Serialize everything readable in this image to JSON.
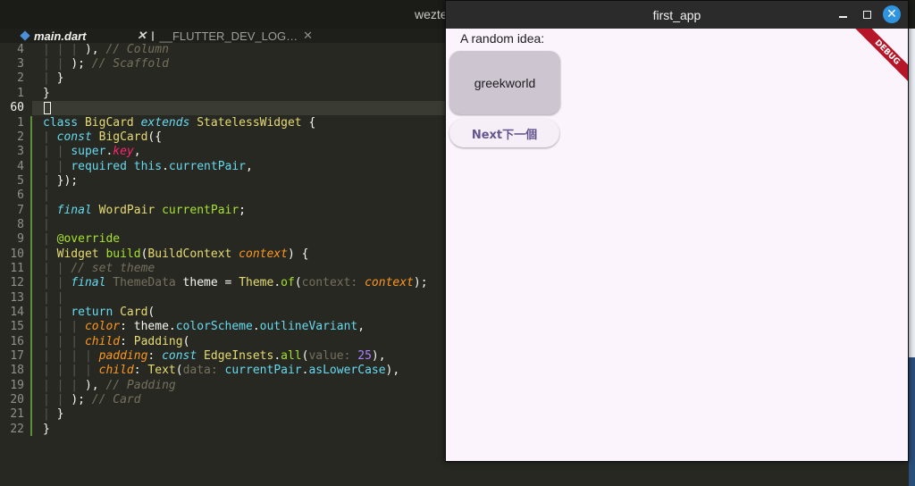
{
  "editor": {
    "window_title": "wezte",
    "tabs": [
      {
        "label": "main.dart",
        "close": "✕"
      },
      {
        "label": "__FLUTTER_DEV_LOG…",
        "close": "✕"
      }
    ],
    "line_numbers": [
      "4",
      "3",
      "2",
      "1",
      "60",
      "1",
      "2",
      "3",
      "4",
      "5",
      "6",
      "7",
      "8",
      "9",
      "10",
      "11",
      "12",
      "13",
      "14",
      "15",
      "16",
      "17",
      "18",
      "19",
      "20",
      "21",
      "22"
    ]
  },
  "app": {
    "title": "first_app",
    "label": "A random idea:",
    "word_pair": "greekworld",
    "next_button": "Next下一個",
    "debug_banner": "DEBUG",
    "close_glyph": "✕"
  }
}
